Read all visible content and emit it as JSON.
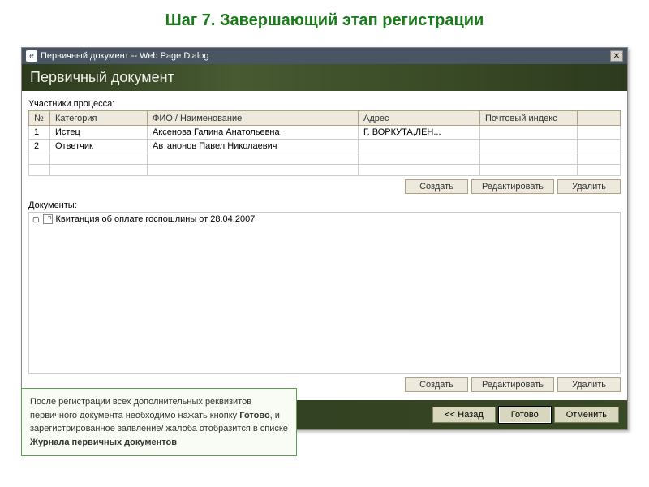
{
  "page_title": "Шаг 7. Завершающий этап регистрации",
  "dialog": {
    "titlebar": "Первичный документ -- Web Page Dialog",
    "banner": "Первичный документ"
  },
  "participants": {
    "label": "Участники процесса:",
    "headers": {
      "num": "№",
      "category": "Категория",
      "name": "ФИО / Наименование",
      "address": "Адрес",
      "postal": "Почтовый индекс"
    },
    "rows": [
      {
        "num": "1",
        "category": "Истец",
        "name": "Аксенова Галина Анатольевна",
        "address": "Г. ВОРКУТА,ЛЕН...",
        "postal": ""
      },
      {
        "num": "2",
        "category": "Ответчик",
        "name": "Автанонов Павел Николаевич",
        "address": "",
        "postal": ""
      }
    ]
  },
  "documents": {
    "label": "Документы:",
    "items": [
      {
        "title": "Квитанция об оплате госпошлины от 28.04.2007"
      }
    ]
  },
  "buttons": {
    "create": "Создать",
    "edit": "Редактировать",
    "delete": "Удалить",
    "back": "<< Назад",
    "done": "Готово",
    "cancel": "Отменить"
  },
  "hint": {
    "p1": "После регистрации всех дополнительных реквизитов первичного документа необходимо нажать кнопку ",
    "b1": "Готово",
    "p2": ", и зарегистрированное  заявление/ жалоба отобразится в списке ",
    "b2": "Журнала первичных  документов"
  }
}
